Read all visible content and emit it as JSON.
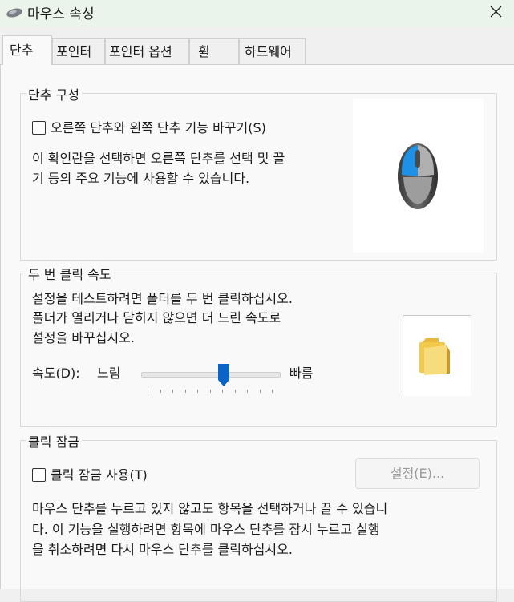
{
  "window": {
    "title": "마우스 속성",
    "close_icon": "close-icon"
  },
  "tabs": [
    {
      "label": "단추"
    },
    {
      "label": "포인터"
    },
    {
      "label": "포인터 옵션"
    },
    {
      "label": "휠"
    },
    {
      "label": "하드웨어"
    }
  ],
  "button_config": {
    "group_label": "단추 구성",
    "swap_label": "오른쪽 단추와 왼쪽 단추 기능 바꾸기(S)",
    "swap_checked": false,
    "description_line1": "이 확인란을 선택하면 오른쪽 단추를 선택 및 끌",
    "description_line2": "기 등의 주요 기능에 사용할 수 있습니다."
  },
  "double_click": {
    "group_label": "두 번 클릭 속도",
    "desc_line1": "설정을 테스트하려면 폴더를 두 번 클릭하십시오.",
    "desc_line2": "폴더가 열리거나 닫히지 않으면 더 느린 속도로",
    "desc_line3": "설정을 바꾸십시오.",
    "speed_label": "속도(D):",
    "slow_label": "느림",
    "fast_label": "빠름",
    "speed_fraction": 0.6
  },
  "click_lock": {
    "group_label": "클릭 잠금",
    "enable_label": "클릭 잠금 사용(T)",
    "enable_checked": false,
    "settings_label": "설정(E)...",
    "desc_line1": "마우스 단추를 누르고 있지 않고도 항목을 선택하거나 끌 수 있습니",
    "desc_line2": "다. 이 기능을 실행하려면 항목에 마우스 단추를 잠시 누르고 실행",
    "desc_line3": "을 취소하려면 다시 마우스 단추를 클릭하십시오."
  },
  "colors": {
    "accent": "#0a64c8",
    "mouse_highlight": "#1e90e6",
    "folder": "#f2c94c"
  }
}
